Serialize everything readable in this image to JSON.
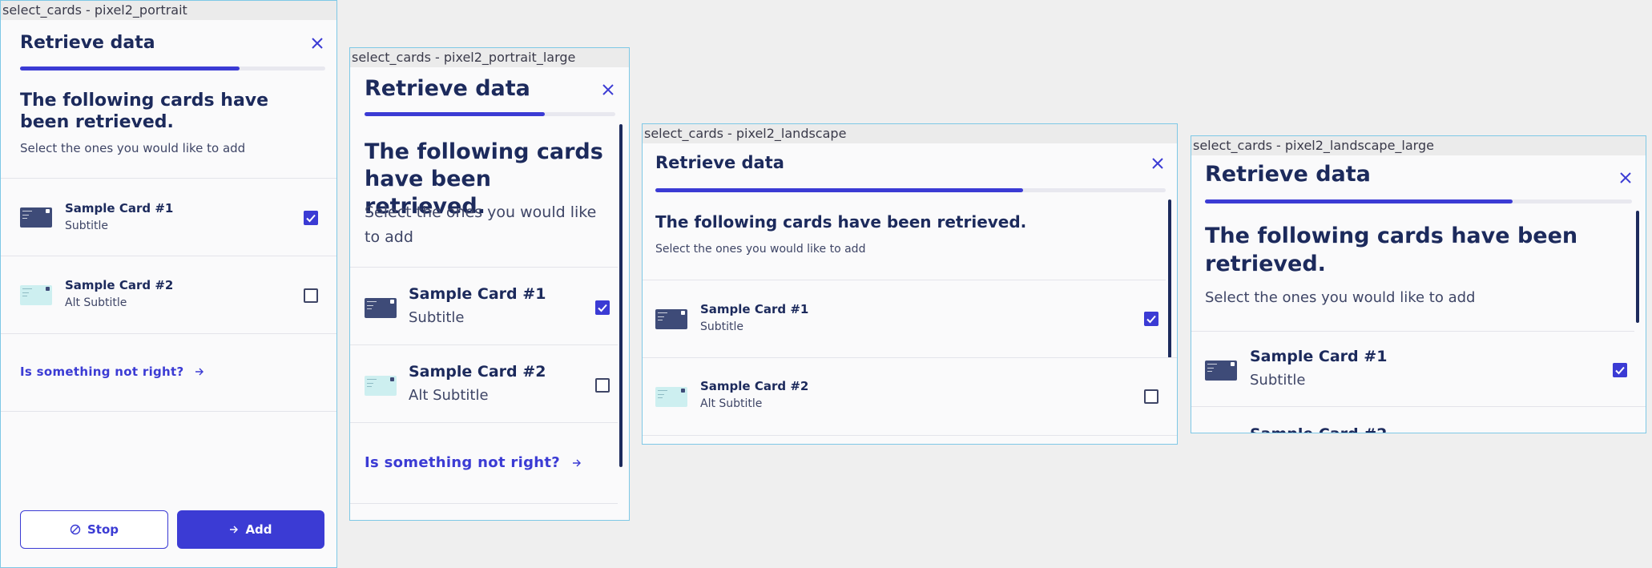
{
  "theme": {
    "accent": "#3b3bd4",
    "navy": "#1c2a5c",
    "frame_border": "#7ec8e6"
  },
  "dialog": {
    "title": "Retrieve data",
    "heading": "The following cards have been retrieved.",
    "subtitle": "Select the ones you would like to add",
    "progress": 0.72,
    "close_icon": "close-icon"
  },
  "cards": [
    {
      "name": "Sample Card #1",
      "subtitle": "Subtitle",
      "checked": true,
      "thumb_style": "dark"
    },
    {
      "name": "Sample Card #2",
      "subtitle": "Alt Subtitle",
      "checked": false,
      "thumb_style": "light"
    }
  ],
  "help": {
    "label": "Is something not right?",
    "icon": "arrow-right-icon"
  },
  "actions": {
    "stop_label": "Stop",
    "stop_icon": "block-icon",
    "add_label": "Add",
    "add_icon": "arrow-right-icon"
  },
  "frames": [
    {
      "caption": "select_cards - pixel2_portrait"
    },
    {
      "caption": "select_cards - pixel2_portrait_large"
    },
    {
      "caption": "select_cards - pixel2_landscape"
    },
    {
      "caption": "select_cards - pixel2_landscape_large"
    }
  ]
}
